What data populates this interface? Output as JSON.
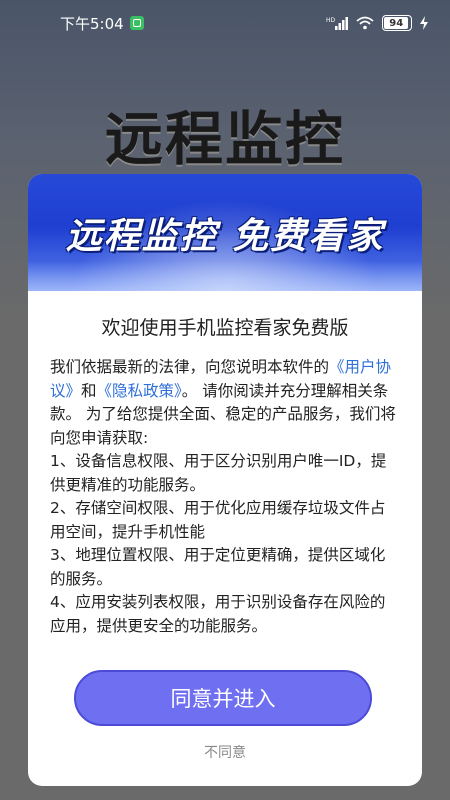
{
  "status_bar": {
    "time": "下午5:04",
    "battery": "94"
  },
  "background": {
    "title": "远程监控"
  },
  "modal": {
    "banner_text": "远程监控 免费看家",
    "title": "欢迎使用手机监控看家免费版",
    "intro_prefix": "我们依据最新的法律，向您说明本软件的",
    "user_agreement_link": "《用户协议》",
    "and": "和",
    "privacy_link": "《隐私政策》",
    "intro_suffix": "。 请你阅读并充分理解相关条款。 为了给您提供全面、稳定的产品服务，我们将向您申请获取:",
    "items": [
      "1、设备信息权限、用于区分识别用户唯一ID，提供更精准的功能服务。",
      "2、存储空间权限、用于优化应用缓存垃圾文件占用空间，提升手机性能",
      "3、地理位置权限、用于定位更精确，提供区域化的服务。",
      "4、应用安装列表权限，用于识别设备存在风险的应用，提供更安全的功能服务。"
    ],
    "agree_label": "同意并进入",
    "disagree_label": "不同意"
  }
}
